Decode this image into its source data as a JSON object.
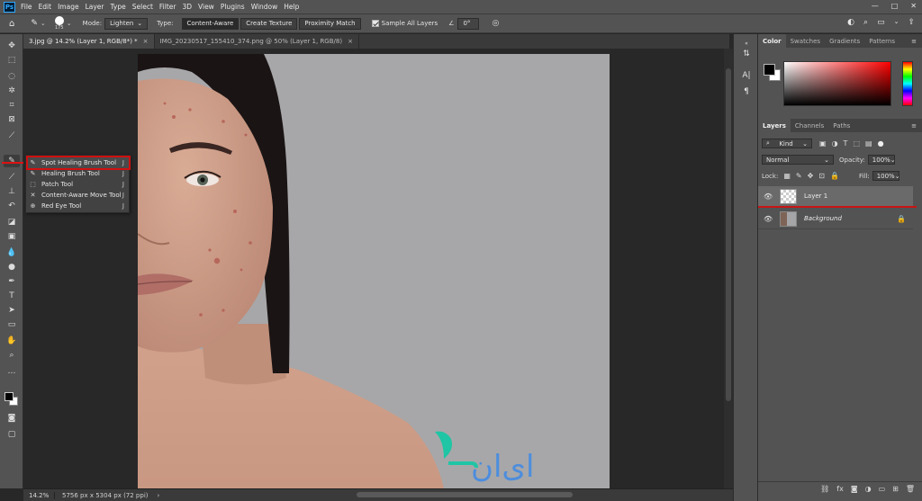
{
  "app": {
    "logo": "Ps",
    "menus": [
      "File",
      "Edit",
      "Image",
      "Layer",
      "Type",
      "Select",
      "Filter",
      "3D",
      "View",
      "Plugins",
      "Window",
      "Help"
    ],
    "window_controls": [
      "—",
      "□",
      "✕"
    ]
  },
  "options": {
    "brush_size": "175",
    "mode_label": "Mode:",
    "mode_value": "Lighten",
    "type_label": "Type:",
    "type_buttons": [
      "Content-Aware",
      "Create Texture",
      "Proximity Match"
    ],
    "sample_all_layers": "Sample All Layers",
    "angle_value": "0°"
  },
  "tabs": [
    {
      "label": "3.jpg @ 14.2% (Layer 1, RGB/8*) *",
      "close": "×"
    },
    {
      "label": "IMG_20230517_155410_374.png @ 50% (Layer 1, RGB/8)",
      "close": "×"
    }
  ],
  "flyout": {
    "items": [
      {
        "label": "Spot Healing Brush Tool",
        "key": "J"
      },
      {
        "label": "Healing Brush Tool",
        "key": "J"
      },
      {
        "label": "Patch Tool",
        "key": "J"
      },
      {
        "label": "Content-Aware Move Tool",
        "key": "J"
      },
      {
        "label": "Red Eye Tool",
        "key": "J"
      }
    ]
  },
  "status": {
    "zoom": "14.2%",
    "doc_info": "5756 px x 5304 px (72 ppi)",
    "arrow": "›"
  },
  "color_panel": {
    "tabs": [
      "Color",
      "Swatches",
      "Gradients",
      "Patterns"
    ],
    "fg_color": "#000000",
    "bg_color": "#ffffff"
  },
  "layers_panel": {
    "tabs": [
      "Layers",
      "Channels",
      "Paths"
    ],
    "kind_label": "Kind",
    "blend_mode": "Normal",
    "opacity_label": "Opacity:",
    "opacity_value": "100%",
    "lock_label": "Lock:",
    "fill_label": "Fill:",
    "fill_value": "100%",
    "layers": [
      {
        "name": "Layer 1",
        "active": true
      },
      {
        "name": "Background",
        "locked": true
      }
    ]
  },
  "watermark_text": "ای‌ان"
}
